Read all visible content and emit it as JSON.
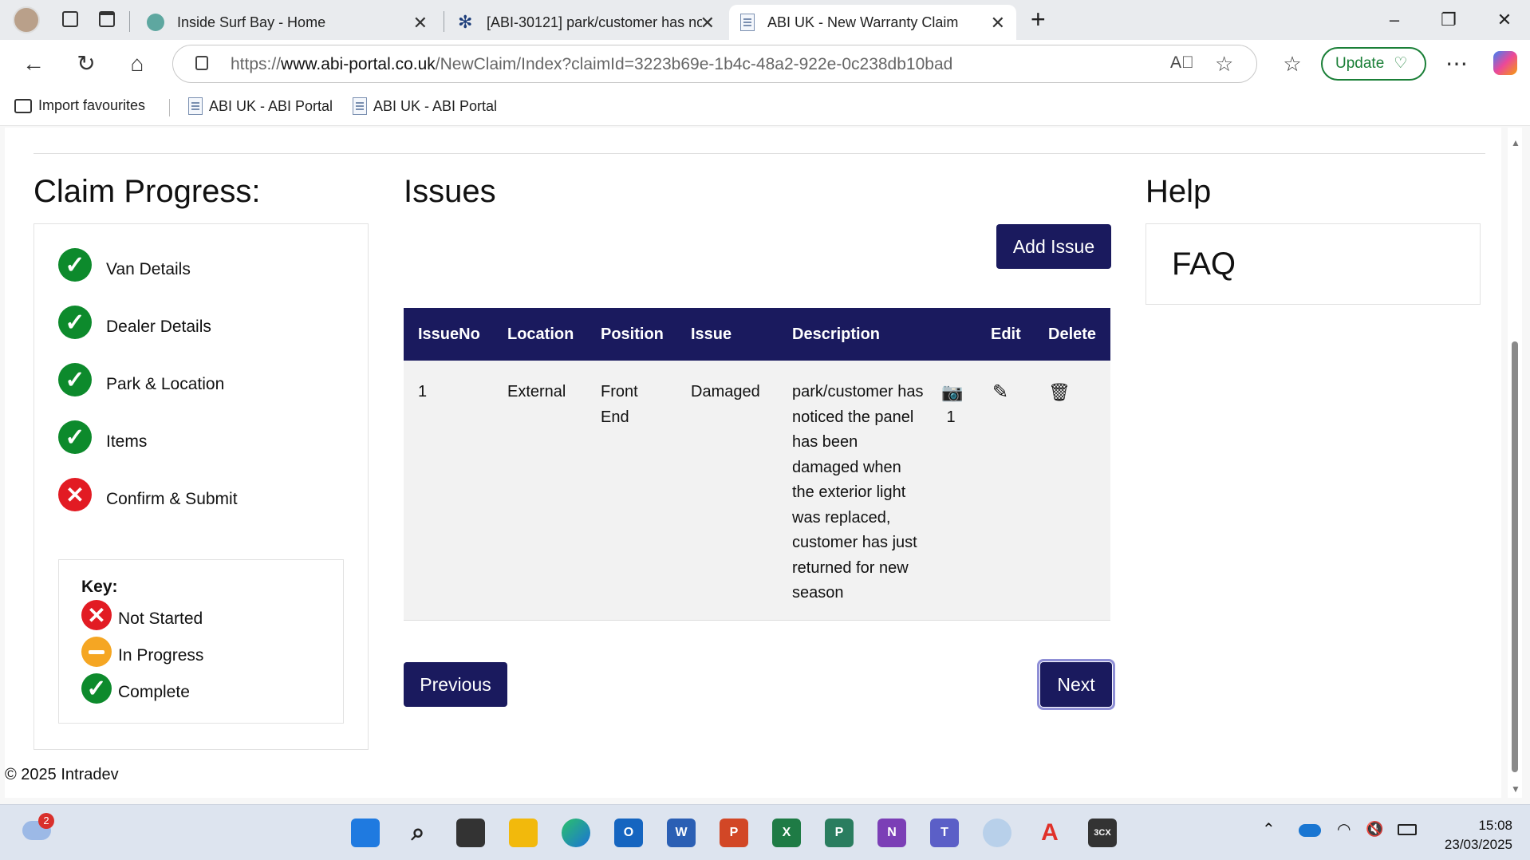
{
  "browser": {
    "tabs": [
      {
        "label": "Inside Surf Bay - Home"
      },
      {
        "label": "[ABI-30121] park/customer has no"
      },
      {
        "label": "ABI UK - New Warranty Claim"
      }
    ],
    "url_prefix": "https://",
    "url_domain": "www.abi-portal.co.uk",
    "url_path": "/NewClaim/Index?claimId=3223b69e-1b4c-48a2-922e-0c238db10bad",
    "update_label": "Update",
    "favourites": [
      {
        "label": "Import favourites"
      },
      {
        "label": "ABI UK - ABI Portal"
      },
      {
        "label": "ABI UK - ABI Portal"
      }
    ]
  },
  "progress": {
    "title": "Claim Progress:",
    "steps": [
      {
        "label": "Van Details",
        "status": "complete"
      },
      {
        "label": "Dealer Details",
        "status": "complete"
      },
      {
        "label": "Park & Location",
        "status": "complete"
      },
      {
        "label": "Items",
        "status": "complete"
      },
      {
        "label": "Confirm & Submit",
        "status": "not-started"
      }
    ],
    "key": {
      "title": "Key:",
      "not_started": "Not Started",
      "in_progress": "In Progress",
      "complete": "Complete"
    }
  },
  "issues": {
    "title": "Issues",
    "add_label": "Add Issue",
    "columns": [
      "IssueNo",
      "Location",
      "Position",
      "Issue",
      "Description",
      "Edit",
      "Delete"
    ],
    "rows": [
      {
        "no": "1",
        "location": "External",
        "position": "Front End",
        "issue": "Damaged",
        "description": "park/customer has noticed the panel has been damaged when the exterior light was replaced, customer has just returned for new season",
        "photo_count": "1"
      }
    ],
    "previous_label": "Previous",
    "next_label": "Next"
  },
  "help": {
    "title": "Help",
    "faq": "FAQ"
  },
  "footer": "© 2025 Intradev",
  "taskbar": {
    "weather_badge": "2",
    "time": "15:08",
    "date": "23/03/2025"
  },
  "colors": {
    "primary": "#1a1a5e",
    "complete": "#0d8a2c",
    "not_started": "#e21b23",
    "in_progress": "#f5a623"
  }
}
